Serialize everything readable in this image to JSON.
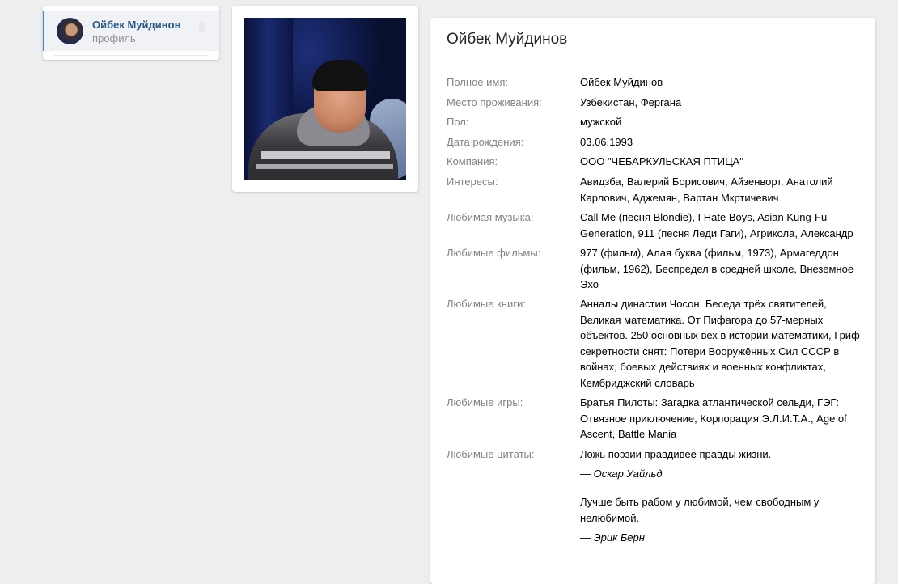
{
  "menu": {
    "name": "Ойбек Муйдинов",
    "subtitle": "профиль"
  },
  "profile": {
    "title": "Ойбек Муйдинов",
    "fields": [
      {
        "label": "Полное имя:",
        "value": "Ойбек Муйдинов"
      },
      {
        "label": "Место проживания:",
        "value": "Узбекистан, Фергана"
      },
      {
        "label": "Пол:",
        "value": "мужской"
      },
      {
        "label": "Дата рождения:",
        "value": "03.06.1993"
      },
      {
        "label": "Компания:",
        "value": "ООО \"ЧЕБАРКУЛЬСКАЯ ПТИЦА\""
      },
      {
        "label": "Интересы:",
        "value": "Авидзба, Валерий Борисович, Айзенворт, Анатолий Карлович, Аджемян, Вартан Мкртичевич"
      },
      {
        "label": "Любимая музыка:",
        "value": "Call Me (песня Blondie), I Hate Boys, Asian Kung-Fu Generation, 911 (песня Леди Гаги), Агрикола, Александр"
      },
      {
        "label": "Любимые фильмы:",
        "value": "977 (фильм), Алая буква (фильм, 1973), Армагеддон (фильм, 1962), Беспредел в средней школе, Внеземное Эхо"
      },
      {
        "label": "Любимые книги:",
        "value": "Анналы династии Чосон, Беседа трёх святителей, Великая математика. От Пифагора до 57-мерных объектов. 250 основных вех в истории математики, Гриф секретности снят: Потери Вооружённых Сил СССР в войнах, боевых действиях и военных конфликтах, Кембриджский словарь"
      },
      {
        "label": "Любимые игры:",
        "value": "Братья Пилоты: Загадка атлантической сельди, ГЭГ: Отвязное приключение, Корпорация Э.Л.И.Т.А., Age of Ascent, Battle Mania"
      }
    ],
    "quotes_label": "Любимые цитаты:",
    "quotes": [
      {
        "text": "Ложь поэзии правдивее правды жизни.",
        "author": "— Оскар Уайльд"
      },
      {
        "text": "Лучше быть рабом у любимой, чем свободным у нелюбимой.",
        "author": "— Эрик Берн"
      }
    ]
  }
}
